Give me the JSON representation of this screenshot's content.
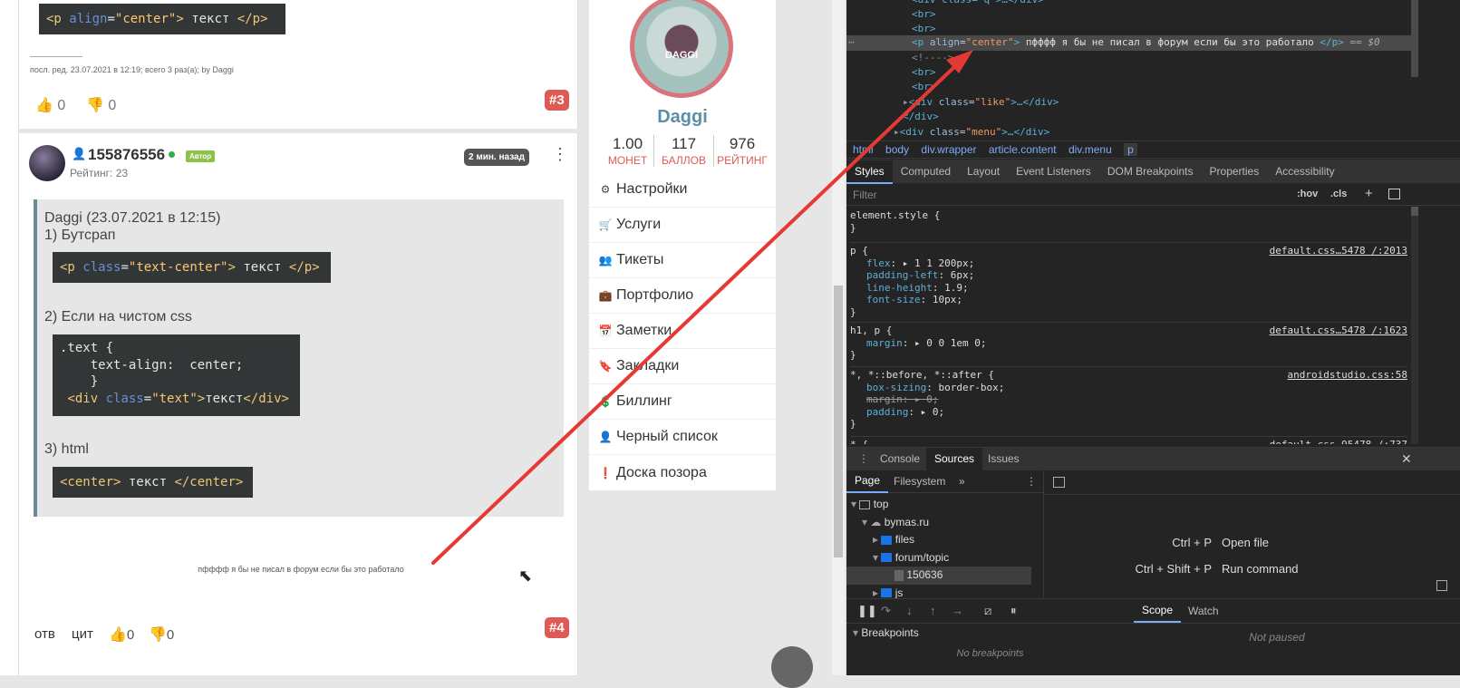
{
  "post3": {
    "code": [
      "<p align=\"center\"> текст </p>"
    ],
    "edited": "посл. ред. 23.07.2021 в 12:19; всего 3 раз(а); by Daggi",
    "likes": "0",
    "dislikes": "0",
    "number": "#3"
  },
  "post4": {
    "username": "155876556",
    "author_badge": "Автор",
    "rating": "Рейтинг: 23",
    "time": "2 мин. назад",
    "quote_header": "Daggi (23.07.2021 в 12:15)",
    "item1": "1) Бутсрап",
    "item2": "2) Если на чистом css",
    "item3": "3) html",
    "body_text": "пфффф я бы не писал в форум если бы это работало",
    "reply": "отв",
    "cite": "цит",
    "likes": "0",
    "dislikes": "0",
    "number": "#4"
  },
  "profile": {
    "avatar_text": "DAGGI",
    "name": "Daggi",
    "stats": [
      {
        "value": "1.00",
        "label": "МОНЕТ"
      },
      {
        "value": "117",
        "label": "БАЛЛОВ"
      },
      {
        "value": "976",
        "label": "РЕЙТИНГ"
      }
    ],
    "menu": [
      "Настройки",
      "Услуги",
      "Тикеты",
      "Портфолио",
      "Заметки",
      "Закладки",
      "Биллинг",
      "Черный список",
      "Доска позора"
    ]
  },
  "devtools": {
    "elements_line": "пфффф я бы не писал в форум если бы это работало",
    "dollar": "== $0",
    "breadcrumbs": [
      "html",
      "body",
      "div.wrapper",
      "article.content",
      "div.menu",
      "p"
    ],
    "tabs": [
      "Styles",
      "Computed",
      "Layout",
      "Event Listeners",
      "DOM Breakpoints",
      "Properties",
      "Accessibility"
    ],
    "filter_placeholder": "Filter",
    "hov": ":hov",
    "cls": ".cls",
    "rules": [
      {
        "selector": "element.style {",
        "src": ""
      },
      {
        "selector": "p {",
        "src": "default.css…5478 /:2013"
      },
      {
        "selector": "h1, p {",
        "src": "default.css…5478 /:1623"
      },
      {
        "selector": "*, *::before, *::after {",
        "src": "androidstudio.css:58"
      },
      {
        "selector": "* {",
        "src": "default.css…95478 /:737"
      }
    ],
    "drawer_tabs": [
      "Console",
      "Sources",
      "Issues"
    ],
    "nav_tabs": [
      "Page",
      "Filesystem"
    ],
    "tree": [
      "top",
      "bymas.ru",
      "files",
      "forum/topic",
      "150636",
      "js"
    ],
    "shortcuts": [
      {
        "keys": "Ctrl + P",
        "action": "Open file"
      },
      {
        "keys": "Ctrl + Shift + P",
        "action": "Run command"
      }
    ],
    "scope_tabs": [
      "Scope",
      "Watch"
    ],
    "breakpoints": "Breakpoints",
    "no_breakpoints": "No breakpoints",
    "not_paused": "Not paused"
  }
}
